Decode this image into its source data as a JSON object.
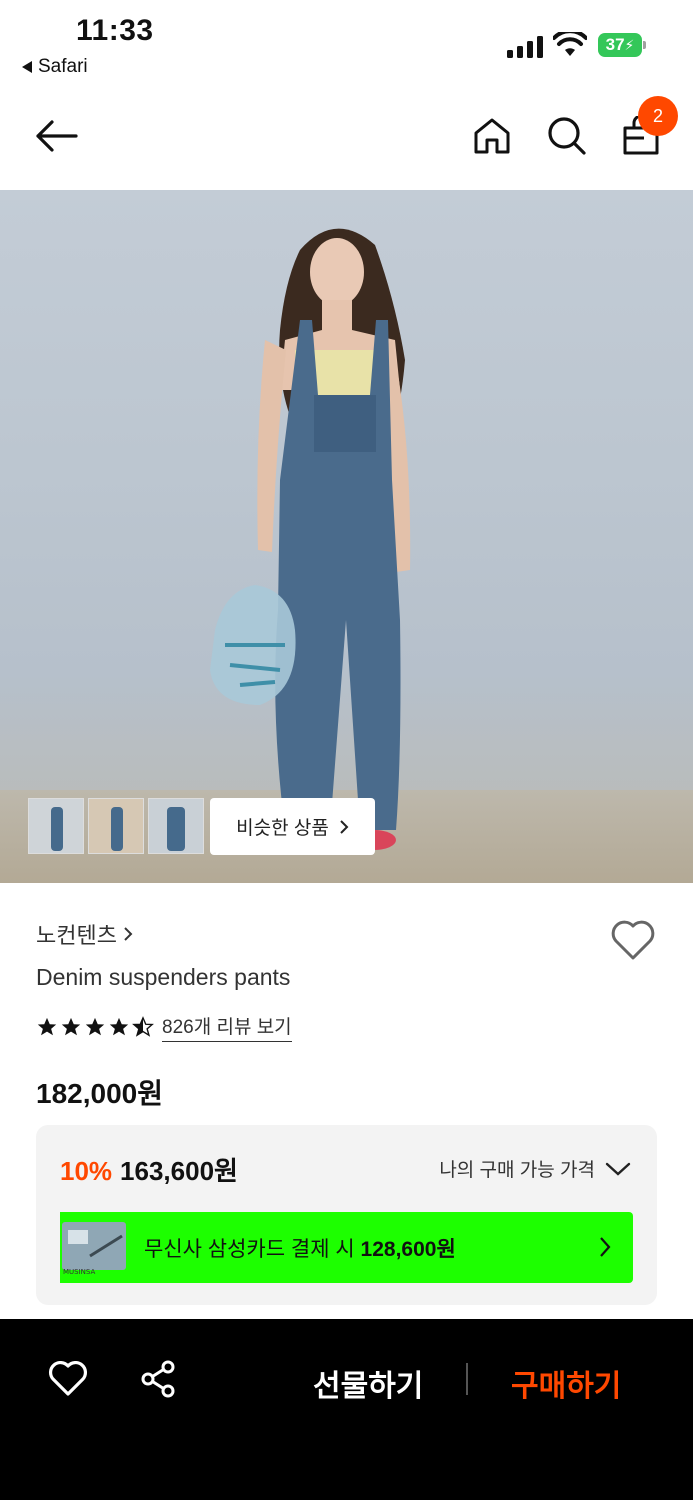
{
  "status_bar": {
    "time": "11:33",
    "back_app": "Safari",
    "battery": "37"
  },
  "nav": {
    "cart_count": "2",
    "icons": [
      "arrow-left-icon",
      "home-icon",
      "search-icon",
      "bag-icon"
    ]
  },
  "gallery": {
    "thumbnail_count": 3,
    "similar_label": "비슷한 상품"
  },
  "product": {
    "brand": "노컨텐츠",
    "name": "Denim suspenders pants",
    "rating": 4.5,
    "review_link": "826개 리뷰 보기",
    "price": "182,000원"
  },
  "price_box": {
    "discount_rate": "10%",
    "discount_price": "163,600원",
    "my_price_label": "나의 구매 가능 가격",
    "card_offer_prefix": "무신사 삼성카드 결제 시 ",
    "card_offer_price": "128,600원"
  },
  "bottom_bar": {
    "gift_label": "선물하기",
    "buy_label": "구매하기"
  },
  "colors": {
    "accent": "#ff4800",
    "card_banner": "#1dff00",
    "bottom_bar": "#000000"
  }
}
